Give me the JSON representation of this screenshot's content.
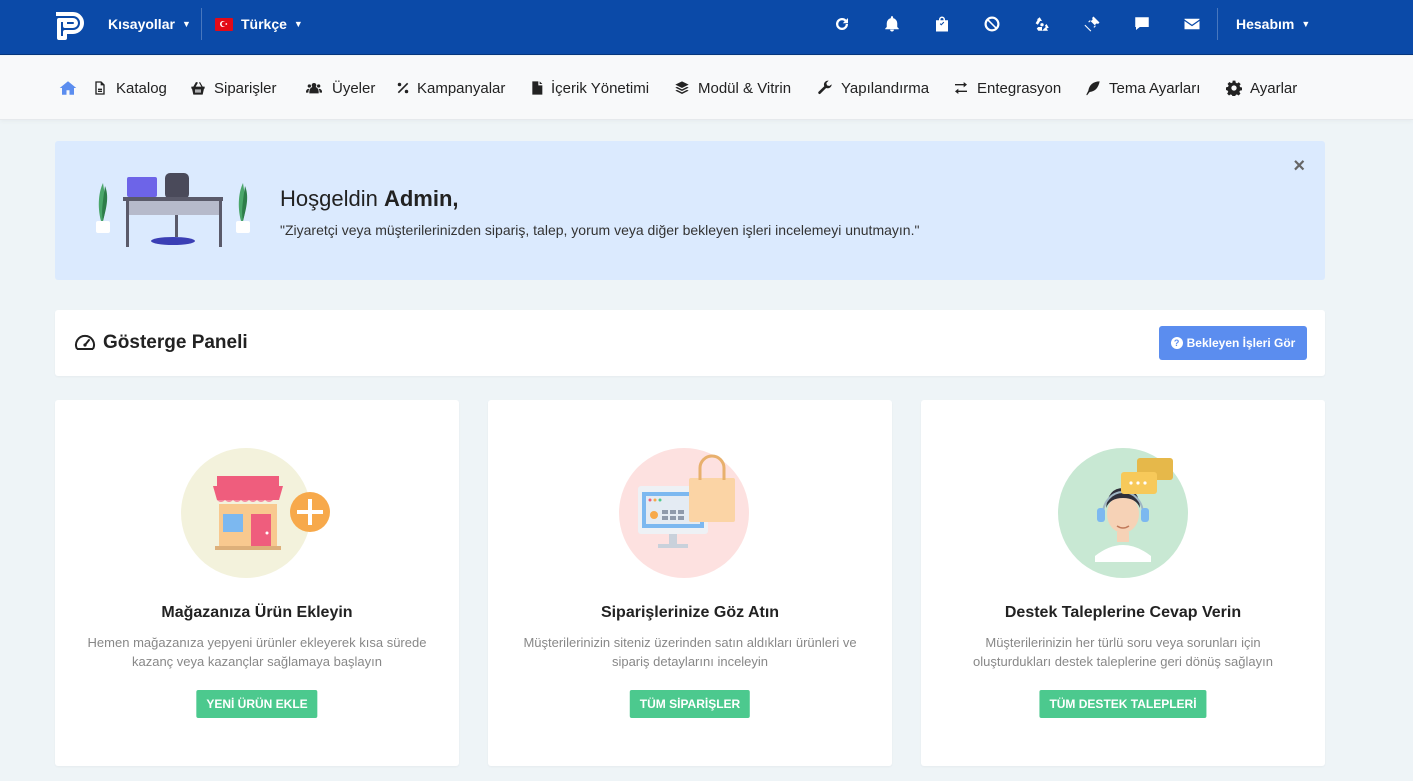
{
  "topbar": {
    "shortcuts_label": "Kısayollar",
    "language_label": "Türkçe",
    "account_label": "Hesabım",
    "icons": [
      "refresh-icon",
      "bell-icon",
      "shopping-bag-icon",
      "ban-icon",
      "recycle-icon",
      "ticket-icon",
      "comment-icon",
      "envelope-icon"
    ]
  },
  "nav": {
    "items": [
      {
        "label": "Katalog",
        "icon": "file-icon"
      },
      {
        "label": "Siparişler",
        "icon": "basket-icon"
      },
      {
        "label": "Üyeler",
        "icon": "users-icon"
      },
      {
        "label": "Kampanyalar",
        "icon": "percent-icon"
      },
      {
        "label": "İçerik Yönetimi",
        "icon": "document-icon"
      },
      {
        "label": "Modül & Vitrin",
        "icon": "layers-icon"
      },
      {
        "label": "Yapılandırma",
        "icon": "wrench-icon"
      },
      {
        "label": "Entegrasyon",
        "icon": "exchange-icon"
      },
      {
        "label": "Tema Ayarları",
        "icon": "feather-icon"
      },
      {
        "label": "Ayarlar",
        "icon": "gear-icon"
      }
    ]
  },
  "banner": {
    "greeting": "Hoşgeldin ",
    "name": "Admin,",
    "message": "\"Ziyaretçi veya müşterilerinizden sipariş, talep, yorum veya diğer bekleyen işleri incelemeyi unutmayın.\"",
    "close": "×"
  },
  "dashboard": {
    "title": "Gösterge Paneli",
    "pending_button": "Bekleyen İşleri Gör"
  },
  "cards": [
    {
      "title": "Mağazanıza Ürün Ekleyin",
      "description": "Hemen mağazanıza yepyeni ürünler ekleyerek kısa sürede kazanç veya kazançlar sağlamaya başlayın",
      "button": "YENİ ÜRÜN EKLE"
    },
    {
      "title": "Siparişlerinize Göz Atın",
      "description": "Müşterilerinizin siteniz üzerinden satın aldıkları ürünleri ve sipariş detaylarını inceleyin",
      "button": "TÜM SİPARİŞLER"
    },
    {
      "title": "Destek Taleplerine Cevap Verin",
      "description": "Müşterilerinizin her türlü soru veya sorunları için oluşturdukları destek taleplerine geri dönüş sağlayın",
      "button": "TÜM DESTEK TALEPLERİ"
    }
  ],
  "colors": {
    "topbar": "#0b4aa8",
    "accent": "#5b8def",
    "success": "#4cc98e",
    "banner_bg": "#dbeafe"
  }
}
